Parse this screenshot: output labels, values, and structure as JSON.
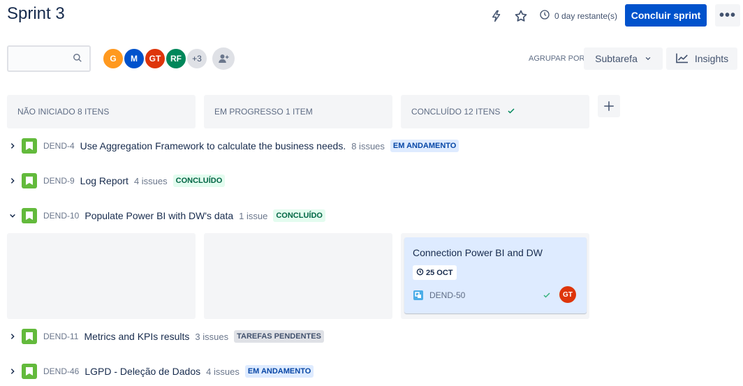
{
  "header": {
    "title": "Sprint 3",
    "remaining": "0 day restante(s)",
    "complete_button": "Concluir sprint",
    "more_label": "•••"
  },
  "toolbar": {
    "search_value": "",
    "avatars": [
      {
        "initials": "G",
        "color": "#ff991f"
      },
      {
        "initials": "M",
        "color": "#0052cc"
      },
      {
        "initials": "GT",
        "color": "#de350b"
      },
      {
        "initials": "RF",
        "color": "#00875a"
      }
    ],
    "avatar_more": "+3",
    "group_by_label": "AGRUPAR POR",
    "group_by_value": "Subtarefa",
    "insights_label": "Insights"
  },
  "columns": [
    {
      "label": "NÃO INICIADO 8 ITENS"
    },
    {
      "label": "EM PROGRESSO 1 ITEM"
    },
    {
      "label": "CONCLUÍDO 12 ITENS"
    }
  ],
  "swimlanes": [
    {
      "key": "DEND-4",
      "summary": "Use Aggregation Framework to calculate the business needs.",
      "count": "8 issues",
      "status": "EM ANDAMENTO",
      "status_type": "blue",
      "expanded": false
    },
    {
      "key": "DEND-9",
      "summary": "Log Report",
      "count": "4 issues",
      "status": "CONCLUÍDO",
      "status_type": "green",
      "expanded": false
    },
    {
      "key": "DEND-10",
      "summary": "Populate Power BI with DW's data",
      "count": "1 issue",
      "status": "CONCLUÍDO",
      "status_type": "green",
      "expanded": true
    },
    {
      "key": "DEND-11",
      "summary": "Metrics and KPIs results",
      "count": "3 issues",
      "status": "TAREFAS PENDENTES",
      "status_type": "grey",
      "expanded": false
    },
    {
      "key": "DEND-46",
      "summary": "LGPD - Deleção de Dados",
      "count": "4 issues",
      "status": "EM ANDAMENTO",
      "status_type": "blue",
      "expanded": false
    }
  ],
  "card": {
    "title": "Connection Power BI and DW",
    "due": "25 OCT",
    "key": "DEND-50",
    "assignee": "GT"
  }
}
